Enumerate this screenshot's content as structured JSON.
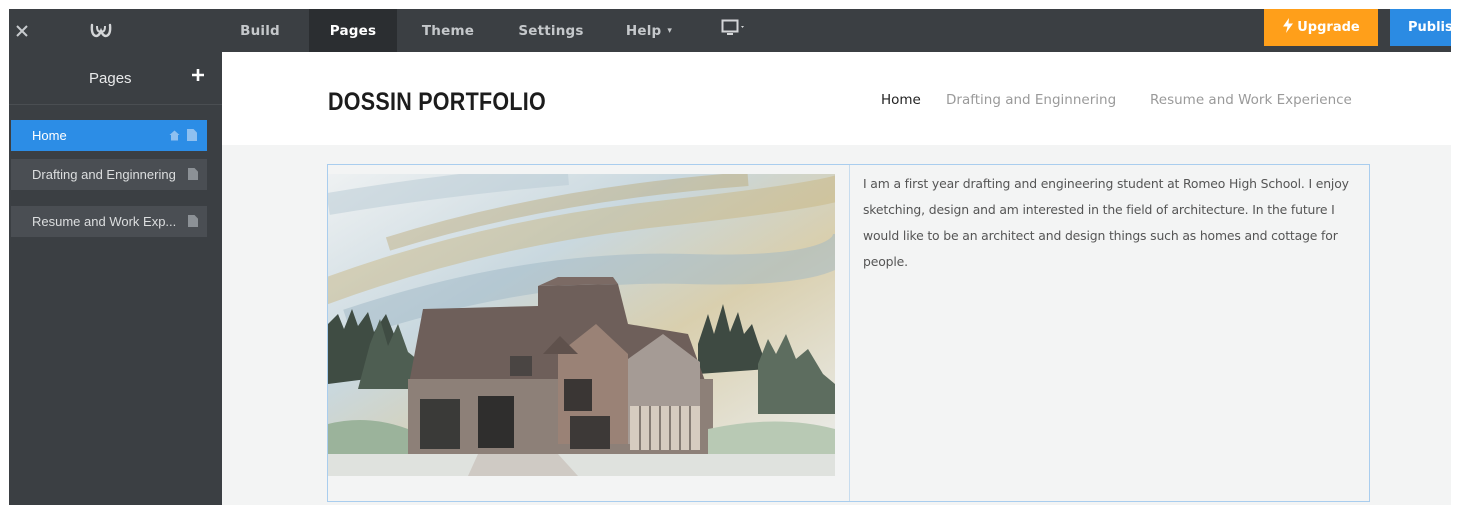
{
  "toolbar": {
    "tabs": [
      {
        "label": "Build",
        "caret": ""
      },
      {
        "label": "Pages",
        "caret": ""
      },
      {
        "label": "Theme",
        "caret": ""
      },
      {
        "label": "Settings",
        "caret": ""
      },
      {
        "label": "Help",
        "caret": "▾"
      }
    ],
    "active_tab": "Pages",
    "upgrade_label": "Upgrade",
    "publish_label": "Publis",
    "colors": {
      "bar": "#3b3f43",
      "upgrade": "#ff9f1a",
      "publish": "#2b8be3"
    }
  },
  "sidebar": {
    "title": "Pages",
    "add_icon": "plus-icon",
    "items": [
      {
        "label": "Home",
        "active": true
      },
      {
        "label": "Drafting and Enginnering",
        "active": false
      },
      {
        "label": "Resume and Work Exp...",
        "active": false
      }
    ]
  },
  "site": {
    "title": "DOSSIN PORTFOLIO",
    "nav": [
      "Home",
      "Drafting and Enginnering",
      "Resume and Work Experience"
    ],
    "bio": "I am a first year drafting and engineering student at Romeo High School. I enjoy sketching, design and am interested in the field of architecture. In the future I would like to be an architect and  design things such as homes and cottage for people."
  }
}
